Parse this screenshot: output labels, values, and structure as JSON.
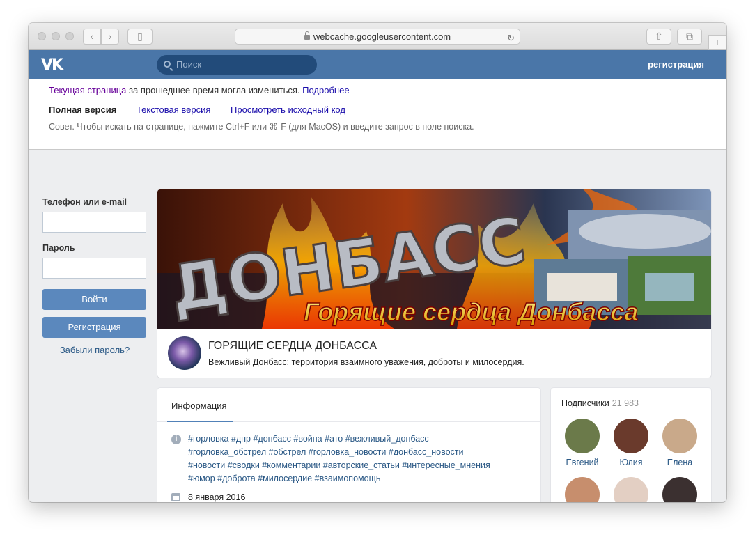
{
  "browser": {
    "url": "webcache.googleusercontent.com",
    "back_icon": "chevron-left-icon",
    "forward_icon": "chevron-right-icon"
  },
  "vk": {
    "logo": "VK",
    "search_placeholder": "Поиск",
    "register_link": "регистрация"
  },
  "cache": {
    "current_page": "Текущая страница",
    "changed_text": "за прошедшее время могла измениться.",
    "more_link": "Подробнее",
    "full_version": "Полная версия",
    "text_version": "Текстовая версия",
    "view_source": "Просмотреть исходный код",
    "tip": "Совет. Чтобы искать на странице, нажмите Ctrl+F или ⌘-F (для MacOS) и введите запрос в поле поиска."
  },
  "login": {
    "phone_label": "Телефон или e-mail",
    "password_label": "Пароль",
    "login_button": "Войти",
    "register_button": "Регистрация",
    "forgot_link": "Забыли пароль?"
  },
  "group": {
    "cover_big_text": "ДОНБАСС",
    "cover_caption": "Горящие сердца Донбасса",
    "title": "ГОРЯЩИЕ СЕРДЦА ДОНБАССА",
    "status": "Вежливый Донбасс: территория взаимного уважения, доброты и милосердия."
  },
  "info": {
    "tab": "Информация",
    "tags_lines": [
      "#горловка #днр #донбасс #война #ато #вежливый_донбасс",
      "#горловка_обстрел #обстрел #горловка_новости #донбасс_новости",
      "#новости #сводки #комментарии #авторские_статьи #интересные_мнения",
      "#юмор #доброта #милосердие #взаимопомощь"
    ],
    "date": "8 января 2016"
  },
  "subscribers": {
    "title": "Подписчики",
    "count": "21 983",
    "people": [
      {
        "name": "Евгений",
        "color": "#6b7a4a"
      },
      {
        "name": "Юлия",
        "color": "#6a3a2c"
      },
      {
        "name": "Елена",
        "color": "#c9a98a"
      },
      {
        "name": "",
        "color": "#c78e6d"
      },
      {
        "name": "",
        "color": "#e3cfc3"
      },
      {
        "name": "",
        "color": "#3b3030"
      }
    ]
  }
}
